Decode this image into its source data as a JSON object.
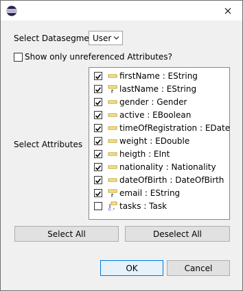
{
  "datasegment": {
    "label": "Select Datasegment",
    "value": "User"
  },
  "show_unreferenced": {
    "label": "Show only unreferenced Attributes?",
    "checked": false
  },
  "attributes": {
    "label": "Select Attributes",
    "items": [
      {
        "text": "firstName : EString",
        "checked": true,
        "icon": "attribute-icon"
      },
      {
        "text": "lastName : EString",
        "checked": true,
        "icon": "key-attribute-icon"
      },
      {
        "text": "gender : Gender",
        "checked": true,
        "icon": "attribute-icon"
      },
      {
        "text": "active : EBoolean",
        "checked": true,
        "icon": "attribute-icon"
      },
      {
        "text": "timeOfRegistration : EDate",
        "checked": true,
        "icon": "attribute-icon"
      },
      {
        "text": "weight : EDouble",
        "checked": true,
        "icon": "attribute-icon"
      },
      {
        "text": "heigth : EInt",
        "checked": true,
        "icon": "attribute-icon"
      },
      {
        "text": "nationality : Nationality",
        "checked": true,
        "icon": "attribute-icon"
      },
      {
        "text": "dateOfBirth : DateOfBirth",
        "checked": true,
        "icon": "attribute-icon"
      },
      {
        "text": "email : EString",
        "checked": true,
        "icon": "key-attribute-icon"
      },
      {
        "text": "tasks : Task",
        "checked": false,
        "icon": "reference-many-icon"
      }
    ]
  },
  "buttons": {
    "select_all": "Select All",
    "deselect_all": "Deselect All",
    "ok": "OK",
    "cancel": "Cancel"
  }
}
